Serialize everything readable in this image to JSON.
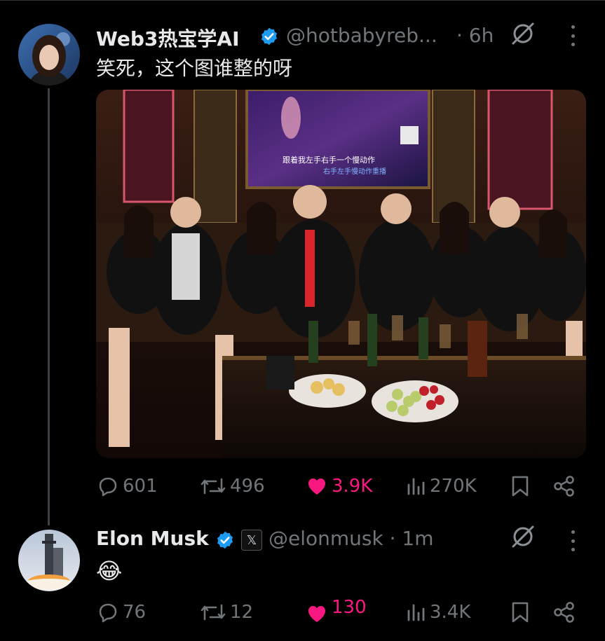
{
  "tweet1": {
    "author_name": "Web3热宝学AI",
    "handle": "@hotbabyreb...",
    "time": "· 6h",
    "text": "笑死，这个图谁整的呀",
    "image_caption_line1": "跟着我左手右手一个慢动作",
    "image_caption_line2": "右手左手慢动作重播",
    "actions": {
      "replies": "601",
      "reposts": "496",
      "likes": "3.9K",
      "views": "270K"
    }
  },
  "tweet2": {
    "author_name": "Elon Musk",
    "badge": "𝕏",
    "handle": "@elonmusk · 1m",
    "text": "😂",
    "actions": {
      "replies": "76",
      "reposts": "12",
      "likes": "130",
      "views": "3.4K"
    }
  },
  "colors": {
    "background": "#000000",
    "muted": "#71767b",
    "verified": "#1d9bf0",
    "like": "#f91880"
  }
}
